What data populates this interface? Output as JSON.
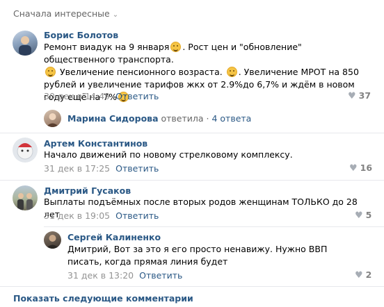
{
  "sort_label": "Сначала интересные",
  "comments": [
    {
      "author": "Борис Болотов",
      "text_parts": [
        "Ремонт виадук на 9 января",
        ". Рост цен и \"обновление\" общественного транспорта.",
        " Увеличение пенсионного возраста.",
        ". Увеличение МРОТ на 850 рублей и увеличение тарифов жкх от 2.9%до 6,7% и ждём в новом году ещё на 7%"
      ],
      "date": "30 дек в 14:49",
      "reply_label": "Ответить",
      "likes": "37"
    },
    {
      "author": "Артем Константинов",
      "text": "Начало движений по новому стрелковому комплексу.",
      "date": "31 дек в 17:25",
      "reply_label": "Ответить",
      "likes": "16"
    },
    {
      "author": "Дмитрий Гусаков",
      "text": "Выплаты подъёмных после вторых родов женщинам ТОЛЬКО до 28 лет",
      "date": "31 дек в 19:05",
      "reply_label": "Ответить",
      "likes": "5"
    }
  ],
  "thread": {
    "name": "Марина Сидорова",
    "verb": "ответила",
    "dot": "·",
    "count": "4 ответа"
  },
  "reply": {
    "author": "Сергей Калиненко",
    "text": "Дмитрий, Вот за это я его просто ненавижу. Нужно ВВП писать, когда прямая линия будет",
    "date": "31 дек в 13:20",
    "reply_label": "Ответить",
    "likes": "2"
  },
  "show_more": "Показать следующие комментарии",
  "icons": {
    "like": "heart-icon",
    "chevron": "chevron-down-icon",
    "emoji": "smile-emoji-icon"
  },
  "colors": {
    "link": "#2a5885",
    "meta": "#939393",
    "separator": "#e7e8ec"
  }
}
